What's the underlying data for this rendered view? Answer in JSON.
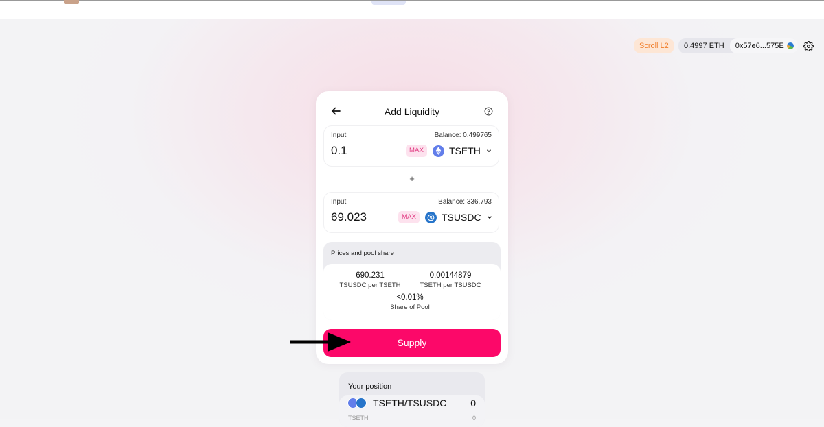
{
  "header": {
    "network": "Scroll L2",
    "balance": "0.4997 ETH",
    "address": "0x57e6...575E"
  },
  "card": {
    "title": "Add Liquidity",
    "input_a": {
      "label": "Input",
      "balance": "Balance: 0.499765",
      "amount": "0.1",
      "max_label": "MAX",
      "token": "TSETH"
    },
    "plus": "+",
    "input_b": {
      "label": "Input",
      "balance": "Balance: 336.793",
      "amount": "69.023",
      "max_label": "MAX",
      "token": "TSUSDC"
    },
    "pool": {
      "title": "Prices and pool share",
      "price_a_value": "690.231",
      "price_a_label": "TSUSDC per TSETH",
      "price_b_value": "0.00144879",
      "price_b_label": "TSETH per TSUSDC",
      "share_value": "<0.01%",
      "share_label": "Share of Pool"
    },
    "supply_label": "Supply"
  },
  "position": {
    "title": "Your position",
    "pair": "TSETH/TSUSDC",
    "value": "0",
    "sub_label": "TSETH",
    "sub_value": "0"
  },
  "colors": {
    "accent": "#fc0869",
    "max_bg": "#fde2ee",
    "max_text": "#e0357e",
    "network_bg": "#fde6d5",
    "network_text": "#f07d2a",
    "eth_token": "#627eea",
    "usdc_token": "#2775ca"
  },
  "icons": {
    "back": "arrow-left-icon",
    "help": "question-circle-icon",
    "settings": "gear-icon",
    "chevron": "chevron-down-icon",
    "pointer": "arrow-right-icon"
  }
}
